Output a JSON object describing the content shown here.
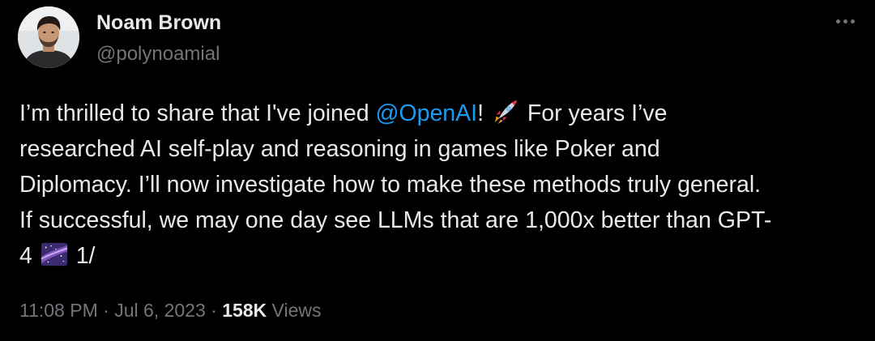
{
  "author": {
    "display_name": "Noam Brown",
    "handle": "@polynoamial",
    "avatar_icon": "profile-photo"
  },
  "tweet": {
    "line1_pre": "I’m thrilled to share that I've joined ",
    "mention": "@OpenAI",
    "line1_post": "! ",
    "emoji_rocket": "rocket-emoji",
    "line1_end": " For years I’ve",
    "line2": "researched AI self-play and reasoning in games like Poker and",
    "line3": "Diplomacy. I’ll now investigate how to make these methods truly general.",
    "line4": "If successful, we may one day see LLMs that are 1,000x better than GPT-",
    "line5_pre": "4 ",
    "emoji_galaxy": "milky-way-emoji",
    "line5_post": " 1/"
  },
  "meta": {
    "time": "11:08 PM",
    "sep1": " · ",
    "date": "Jul 6, 2023",
    "sep2": " · ",
    "views_count": "158K",
    "views_label": " Views"
  },
  "colors": {
    "background": "#000000",
    "text": "#e7e9ea",
    "secondary": "#71767b",
    "link": "#1d9bf0"
  },
  "more_icon": "more-horizontal-icon"
}
